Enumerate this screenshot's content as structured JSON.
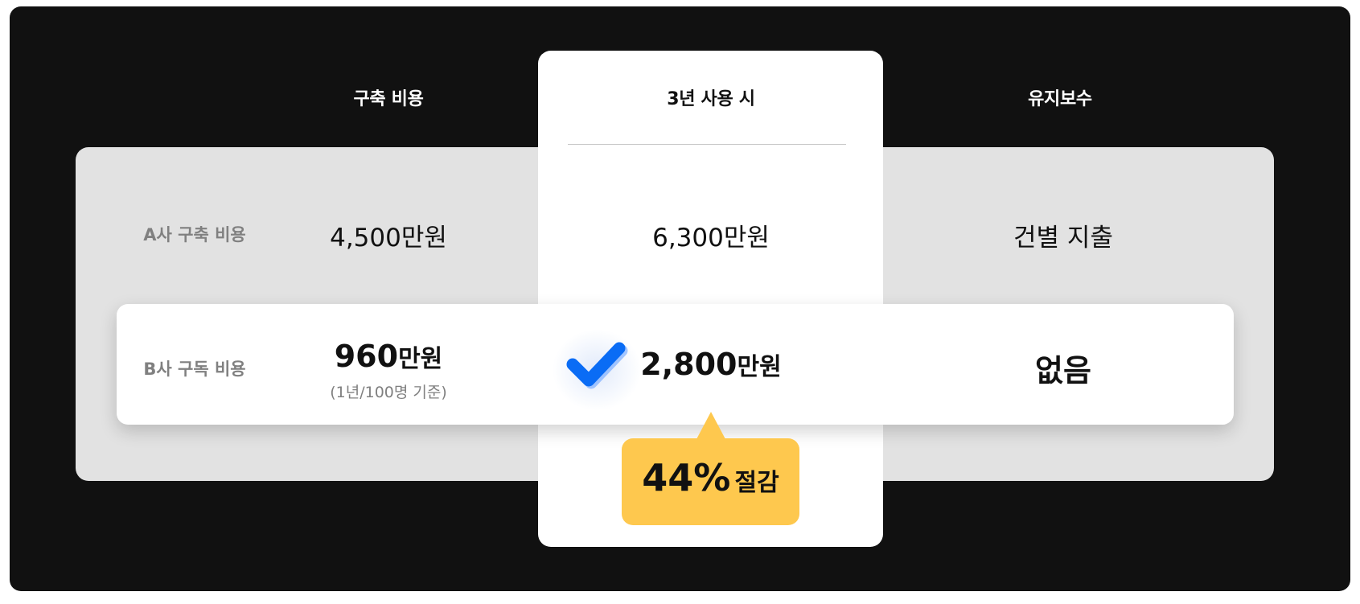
{
  "columns": {
    "build_cost": "구축 비용",
    "three_year": "3년 사용 시",
    "maintenance": "유지보수"
  },
  "row_a": {
    "label": "A사 구축 비용",
    "build_cost": "4,500만원",
    "three_year": "6,300만원",
    "maintenance": "건별 지출"
  },
  "row_b": {
    "label": "B사 구독 비용",
    "build_cost_number": "960",
    "build_cost_unit": "만원",
    "build_cost_note": "(1년/100명 기준)",
    "three_year_number": "2,800",
    "three_year_unit": "만원",
    "maintenance": "없음"
  },
  "savings": {
    "percent": "44%",
    "word": "절감"
  },
  "icons": {
    "check": "check-icon"
  },
  "colors": {
    "background": "#111111",
    "panel": "#e2e2e2",
    "highlight_card": "#ffffff",
    "check_blue": "#0a6cf5",
    "badge_yellow": "#fec84e",
    "muted_text": "#808080"
  }
}
